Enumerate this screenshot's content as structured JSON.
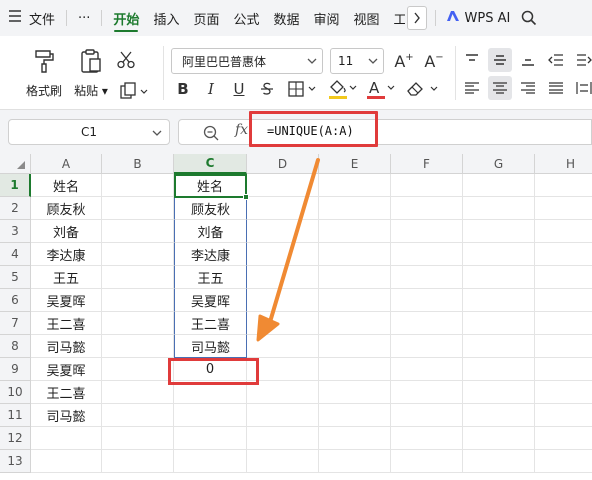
{
  "menubar": {
    "file": "文件",
    "more": "···",
    "tabs": [
      "开始",
      "插入",
      "页面",
      "公式",
      "数据",
      "审阅",
      "视图",
      "工"
    ],
    "ai": "WPS AI"
  },
  "ribbon": {
    "format_painter": "格式刷",
    "paste": "粘贴",
    "font_name": "阿里巴巴普惠体",
    "font_size": "11",
    "bold": "B",
    "italic": "I",
    "underline": "U",
    "font_color_letter": "A",
    "grow_font": "A",
    "shrink_font": "A"
  },
  "formula_bar": {
    "cell_ref": "C1",
    "fx": "fx",
    "formula": "=UNIQUE(A:A)"
  },
  "grid": {
    "columns": [
      "A",
      "B",
      "C",
      "D",
      "E",
      "F",
      "G",
      "H"
    ],
    "rows": [
      "1",
      "2",
      "3",
      "4",
      "5",
      "6",
      "7",
      "8",
      "9",
      "10",
      "11",
      "12",
      "13"
    ],
    "column_a": [
      "姓名",
      "顾友秋",
      "刘备",
      "李达康",
      "王五",
      "吴夏晖",
      "王二喜",
      "司马懿",
      "吴夏晖",
      "王二喜",
      "司马懿"
    ],
    "column_c": [
      "姓名",
      "顾友秋",
      "刘备",
      "李达康",
      "王五",
      "吴夏晖",
      "王二喜",
      "司马懿",
      "0"
    ]
  },
  "colors": {
    "accent_green": "#1d7a2e",
    "highlight_red": "#e03b3b",
    "arrow_orange": "#f08a33",
    "spill_border_blue": "#4a6fb3"
  }
}
